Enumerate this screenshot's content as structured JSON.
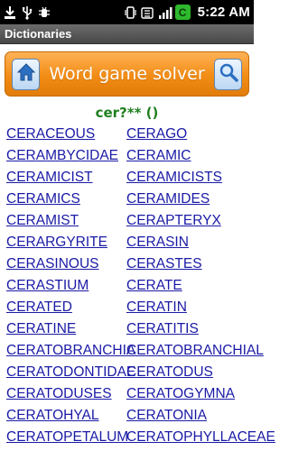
{
  "status_bar": {
    "time": "5:22 AM",
    "battery_label": "C",
    "icons": [
      "download-icon",
      "usb-icon",
      "debug-icon",
      "vibrate-icon",
      "wifi-icon",
      "signal-icon",
      "battery-icon"
    ]
  },
  "title_bar": {
    "title": "Dictionaries"
  },
  "banner": {
    "title": "Word game solver",
    "left_icon": "home-icon",
    "right_icon": "search-icon",
    "accent": "#f28c14"
  },
  "query": {
    "pattern": "cer?** ()"
  },
  "words": [
    "CERACEOUS",
    "CERAGO",
    "CERAMBYCIDAE",
    "CERAMIC",
    "CERAMICIST",
    "CERAMICISTS",
    "CERAMICS",
    "CERAMIDES",
    "CERAMIST",
    "CERAPTERYX",
    "CERARGYRITE",
    "CERASIN",
    "CERASINOUS",
    "CERASTES",
    "CERASTIUM",
    "CERATE",
    "CERATED",
    "CERATIN",
    "CERATINE",
    "CERATITIS",
    "CERATOBRANCHIA",
    "CERATOBRANCHIAL",
    "CERATODONTIDAE",
    "CERATODUS",
    "CERATODUSES",
    "CERATOGYMNA",
    "CERATOHYAL",
    "CERATONIA",
    "CERATOPETALUM",
    "CERATOPHYLLACEAE"
  ],
  "colors": {
    "link": "#1a1aa6",
    "query": "#1e7f1e",
    "title_bar": "#5a5a5a",
    "status_bar": "#000000"
  }
}
